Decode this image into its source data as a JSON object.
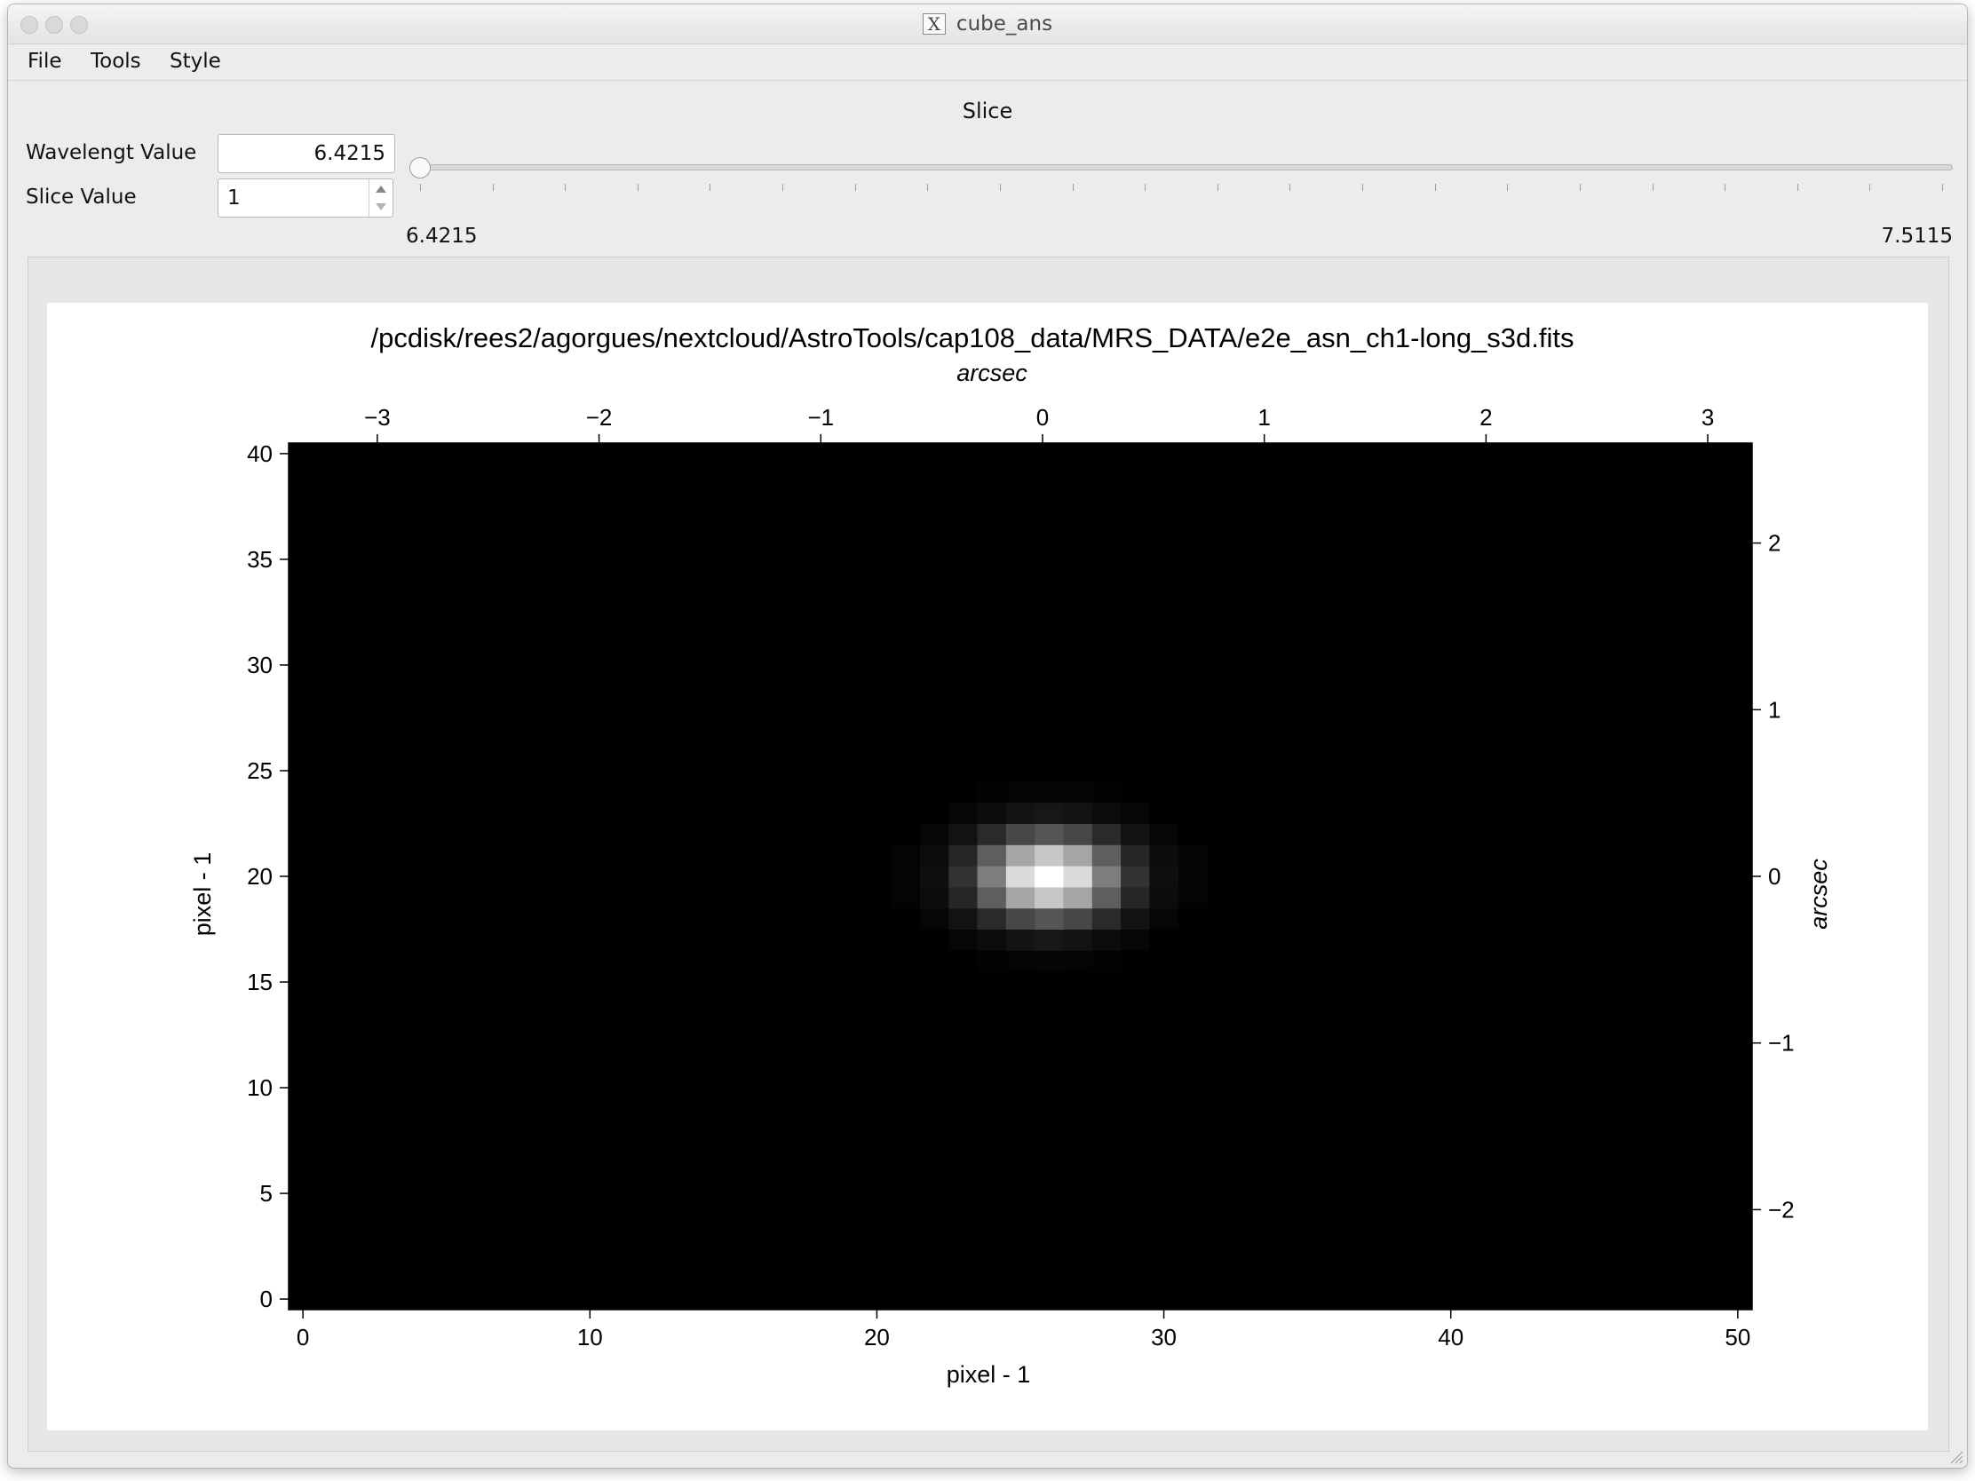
{
  "window": {
    "title": "cube_ans",
    "app_icon": "x11-icon"
  },
  "menu": {
    "items": [
      "File",
      "Tools",
      "Style"
    ]
  },
  "controls": {
    "heading": "Slice",
    "wavelength_label": "Wavelengt Value",
    "wavelength_value": "6.4215",
    "slice_label": "Slice Value",
    "slice_value": "1",
    "slider_min_label": "6.4215",
    "slider_max_label": "7.5115",
    "slider_position": 0
  },
  "chart_data": {
    "type": "heatmap",
    "title": "/pcdisk/rees2/agorgues/nextcloud/AstroTools/cap108_data/MRS_DATA/e2e_asn_ch1-long_s3d.fits",
    "xlabel": "pixel - 1",
    "ylabel": "pixel - 1",
    "top_xlabel": "arcsec",
    "right_ylabel": "arcsec",
    "xlim": [
      -0.5,
      50.5
    ],
    "ylim": [
      -0.5,
      40.5
    ],
    "x_ticks": [
      0,
      10,
      20,
      30,
      40,
      50
    ],
    "y_ticks": [
      0,
      5,
      10,
      15,
      20,
      25,
      30,
      35,
      40
    ],
    "top_xlim": [
      -3.4,
      3.2
    ],
    "top_x_ticks": [
      "−3",
      "−2",
      "−1",
      "0",
      "1",
      "2",
      "3"
    ],
    "top_x_values": [
      -3,
      -2,
      -1,
      0,
      1,
      2,
      3
    ],
    "right_ylim": [
      -2.6,
      2.6
    ],
    "right_y_ticks": [
      "−2",
      "−1",
      "0",
      "1",
      "2"
    ],
    "right_y_values": [
      -2,
      -1,
      0,
      1,
      2
    ],
    "colormap": "gray",
    "source": {
      "x": 26,
      "y": 20,
      "sigma_x": 1.6,
      "sigma_y": 1.3
    },
    "grid": false
  }
}
